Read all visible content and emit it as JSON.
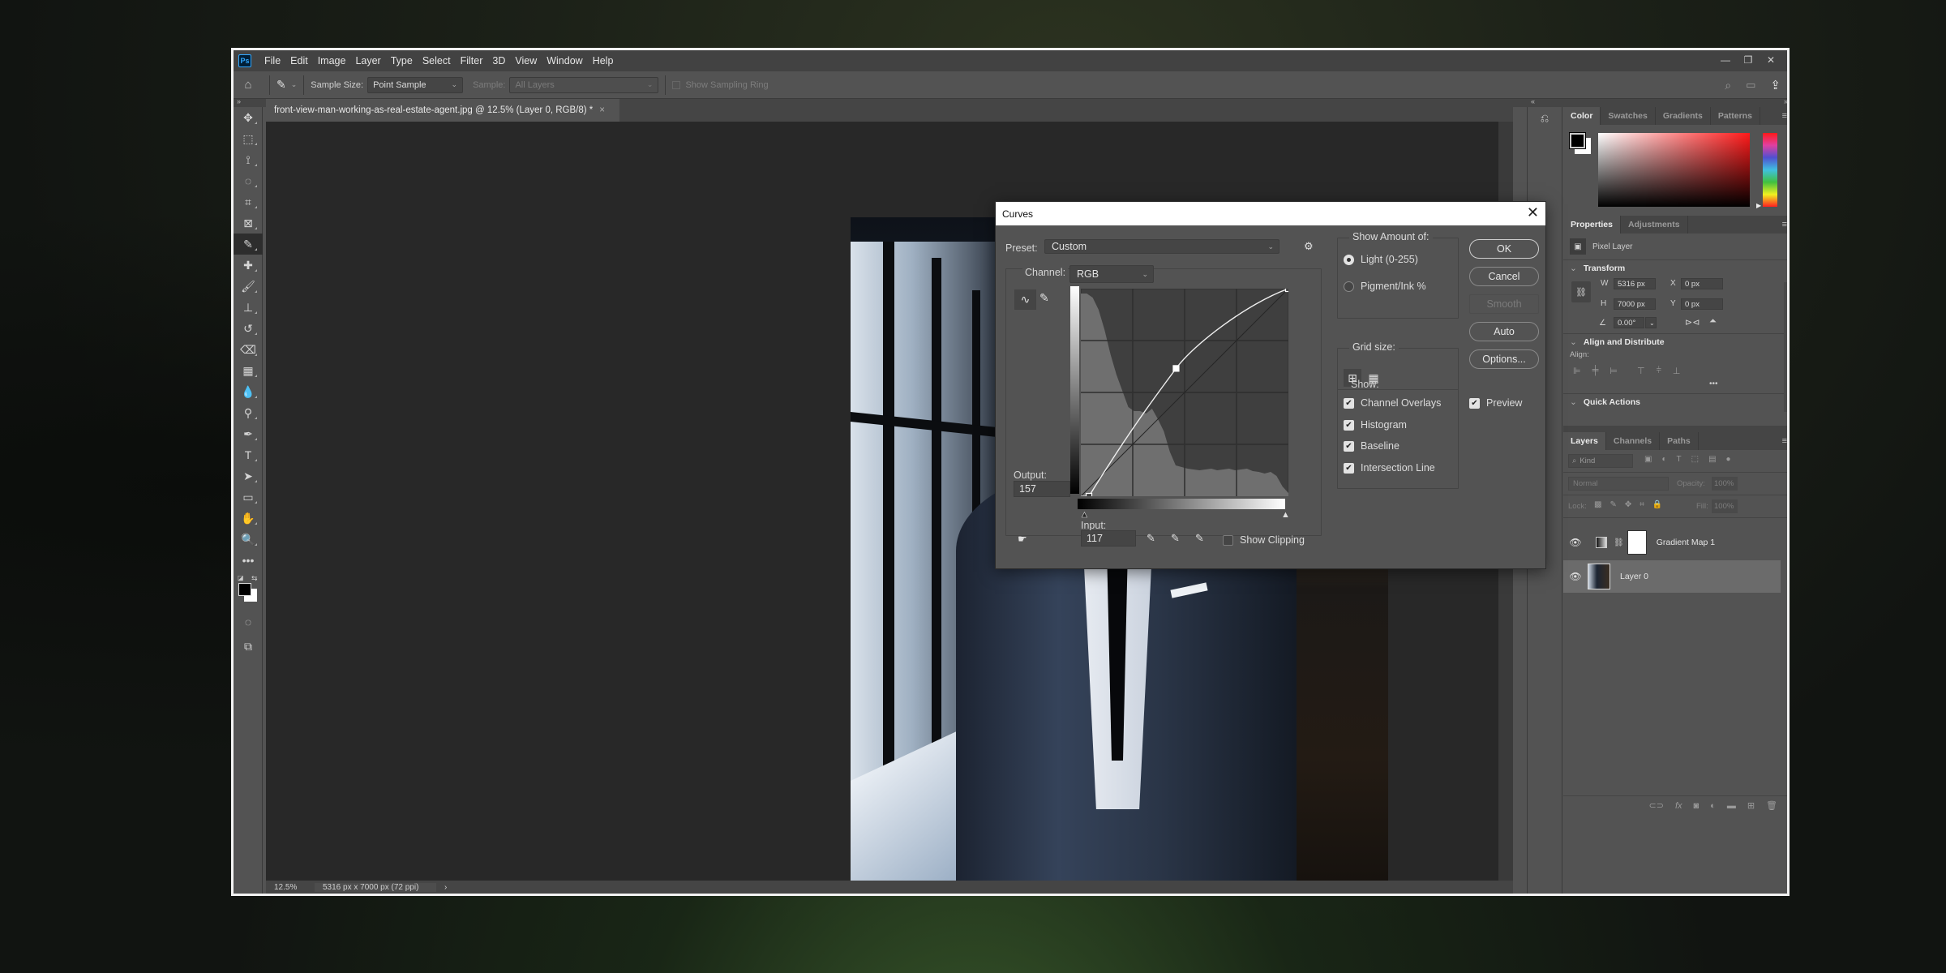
{
  "app": {
    "logo": "Ps",
    "menu": [
      "File",
      "Edit",
      "Image",
      "Layer",
      "Type",
      "Select",
      "Filter",
      "3D",
      "View",
      "Window",
      "Help"
    ],
    "window_controls": {
      "minimize": "minimize-icon",
      "restore": "restore-icon",
      "close": "close-icon"
    }
  },
  "options_bar": {
    "home_icon": "home-icon",
    "tool_icon": "eyedropper-icon",
    "sample_size_label": "Sample Size:",
    "sample_size_value": "Point Sample",
    "sample_label": "Sample:",
    "sample_value": "All Layers",
    "show_sampling_ring": "Show Sampling Ring",
    "search_icon": "search-icon",
    "workspace_icon": "workspace-icon",
    "share_icon": "share-icon"
  },
  "document": {
    "tab_title": "front-view-man-working-as-real-estate-agent.jpg @ 12.5% (Layer 0, RGB/8) *",
    "tab_close": "×",
    "status_zoom": "12.5%",
    "status_info": "5316 px x 7000 px (72 ppi)",
    "status_arrow": "›"
  },
  "tools": [
    {
      "name": "move-tool",
      "glyph": "✥"
    },
    {
      "name": "marquee-tool",
      "glyph": "⬚"
    },
    {
      "name": "lasso-tool",
      "glyph": "⟟"
    },
    {
      "name": "quick-selection-tool",
      "glyph": "◌"
    },
    {
      "name": "crop-tool",
      "glyph": "⌗"
    },
    {
      "name": "frame-tool",
      "glyph": "⊠"
    },
    {
      "name": "eyedropper-tool",
      "glyph": "✎",
      "active": true
    },
    {
      "name": "healing-brush-tool",
      "glyph": "✚"
    },
    {
      "name": "brush-tool",
      "glyph": "🖌"
    },
    {
      "name": "clone-stamp-tool",
      "glyph": "⊥"
    },
    {
      "name": "history-brush-tool",
      "glyph": "↺"
    },
    {
      "name": "eraser-tool",
      "glyph": "⌫"
    },
    {
      "name": "gradient-tool",
      "glyph": "▦"
    },
    {
      "name": "blur-tool",
      "glyph": "💧"
    },
    {
      "name": "dodge-tool",
      "glyph": "⚲"
    },
    {
      "name": "pen-tool",
      "glyph": "✒"
    },
    {
      "name": "type-tool",
      "glyph": "T"
    },
    {
      "name": "path-selection-tool",
      "glyph": "➤"
    },
    {
      "name": "rectangle-tool",
      "glyph": "▭"
    },
    {
      "name": "hand-tool",
      "glyph": "✋"
    },
    {
      "name": "zoom-tool",
      "glyph": "🔍"
    },
    {
      "name": "edit-toolbar",
      "glyph": "•••"
    }
  ],
  "curves": {
    "title": "Curves",
    "preset_label": "Preset:",
    "preset_value": "Custom",
    "channel_label": "Channel:",
    "channel_value": "RGB",
    "output_label": "Output:",
    "output_value": "157",
    "input_label": "Input:",
    "input_value": "117",
    "show_clipping": "Show Clipping",
    "show_amount_title": "Show Amount of:",
    "light_option": "Light  (0-255)",
    "pigment_option": "Pigment/Ink %",
    "grid_size_title": "Grid size:",
    "show_title": "Show:",
    "show_options": [
      "Channel Overlays",
      "Histogram",
      "Baseline",
      "Intersection Line"
    ],
    "buttons": {
      "ok": "OK",
      "cancel": "Cancel",
      "smooth": "Smooth",
      "auto": "Auto",
      "options": "Options..."
    },
    "preview_label": "Preview",
    "curve_points": [
      [
        10,
        0
      ],
      [
        117,
        157
      ],
      [
        255,
        255
      ]
    ]
  },
  "color_panel": {
    "tabs": [
      "Color",
      "Swatches",
      "Gradients",
      "Patterns"
    ],
    "foreground": "#000000",
    "background": "#ffffff",
    "hue": "#ff1a1a"
  },
  "properties_panel": {
    "tabs": [
      "Properties",
      "Adjustments"
    ],
    "layer_type": "Pixel Layer",
    "transform_title": "Transform",
    "w_label": "W",
    "w_value": "5316 px",
    "h_label": "H",
    "h_value": "7000 px",
    "x_label": "X",
    "x_value": "0 px",
    "y_label": "Y",
    "y_value": "0 px",
    "angle_value": "0.00°",
    "align_title": "Align and Distribute",
    "align_label": "Align:",
    "more": "•••",
    "quick_actions_title": "Quick Actions"
  },
  "layers_panel": {
    "tabs": [
      "Layers",
      "Channels",
      "Paths"
    ],
    "filter_placeholder": "Kind",
    "blend_mode": "Normal",
    "opacity_label": "Opacity:",
    "opacity_value": "100%",
    "lock_label": "Lock:",
    "fill_label": "Fill:",
    "fill_value": "100%",
    "layers": [
      {
        "name": "Gradient Map 1",
        "visible": true,
        "selected": false
      },
      {
        "name": "Layer 0",
        "visible": true,
        "selected": true
      }
    ]
  }
}
